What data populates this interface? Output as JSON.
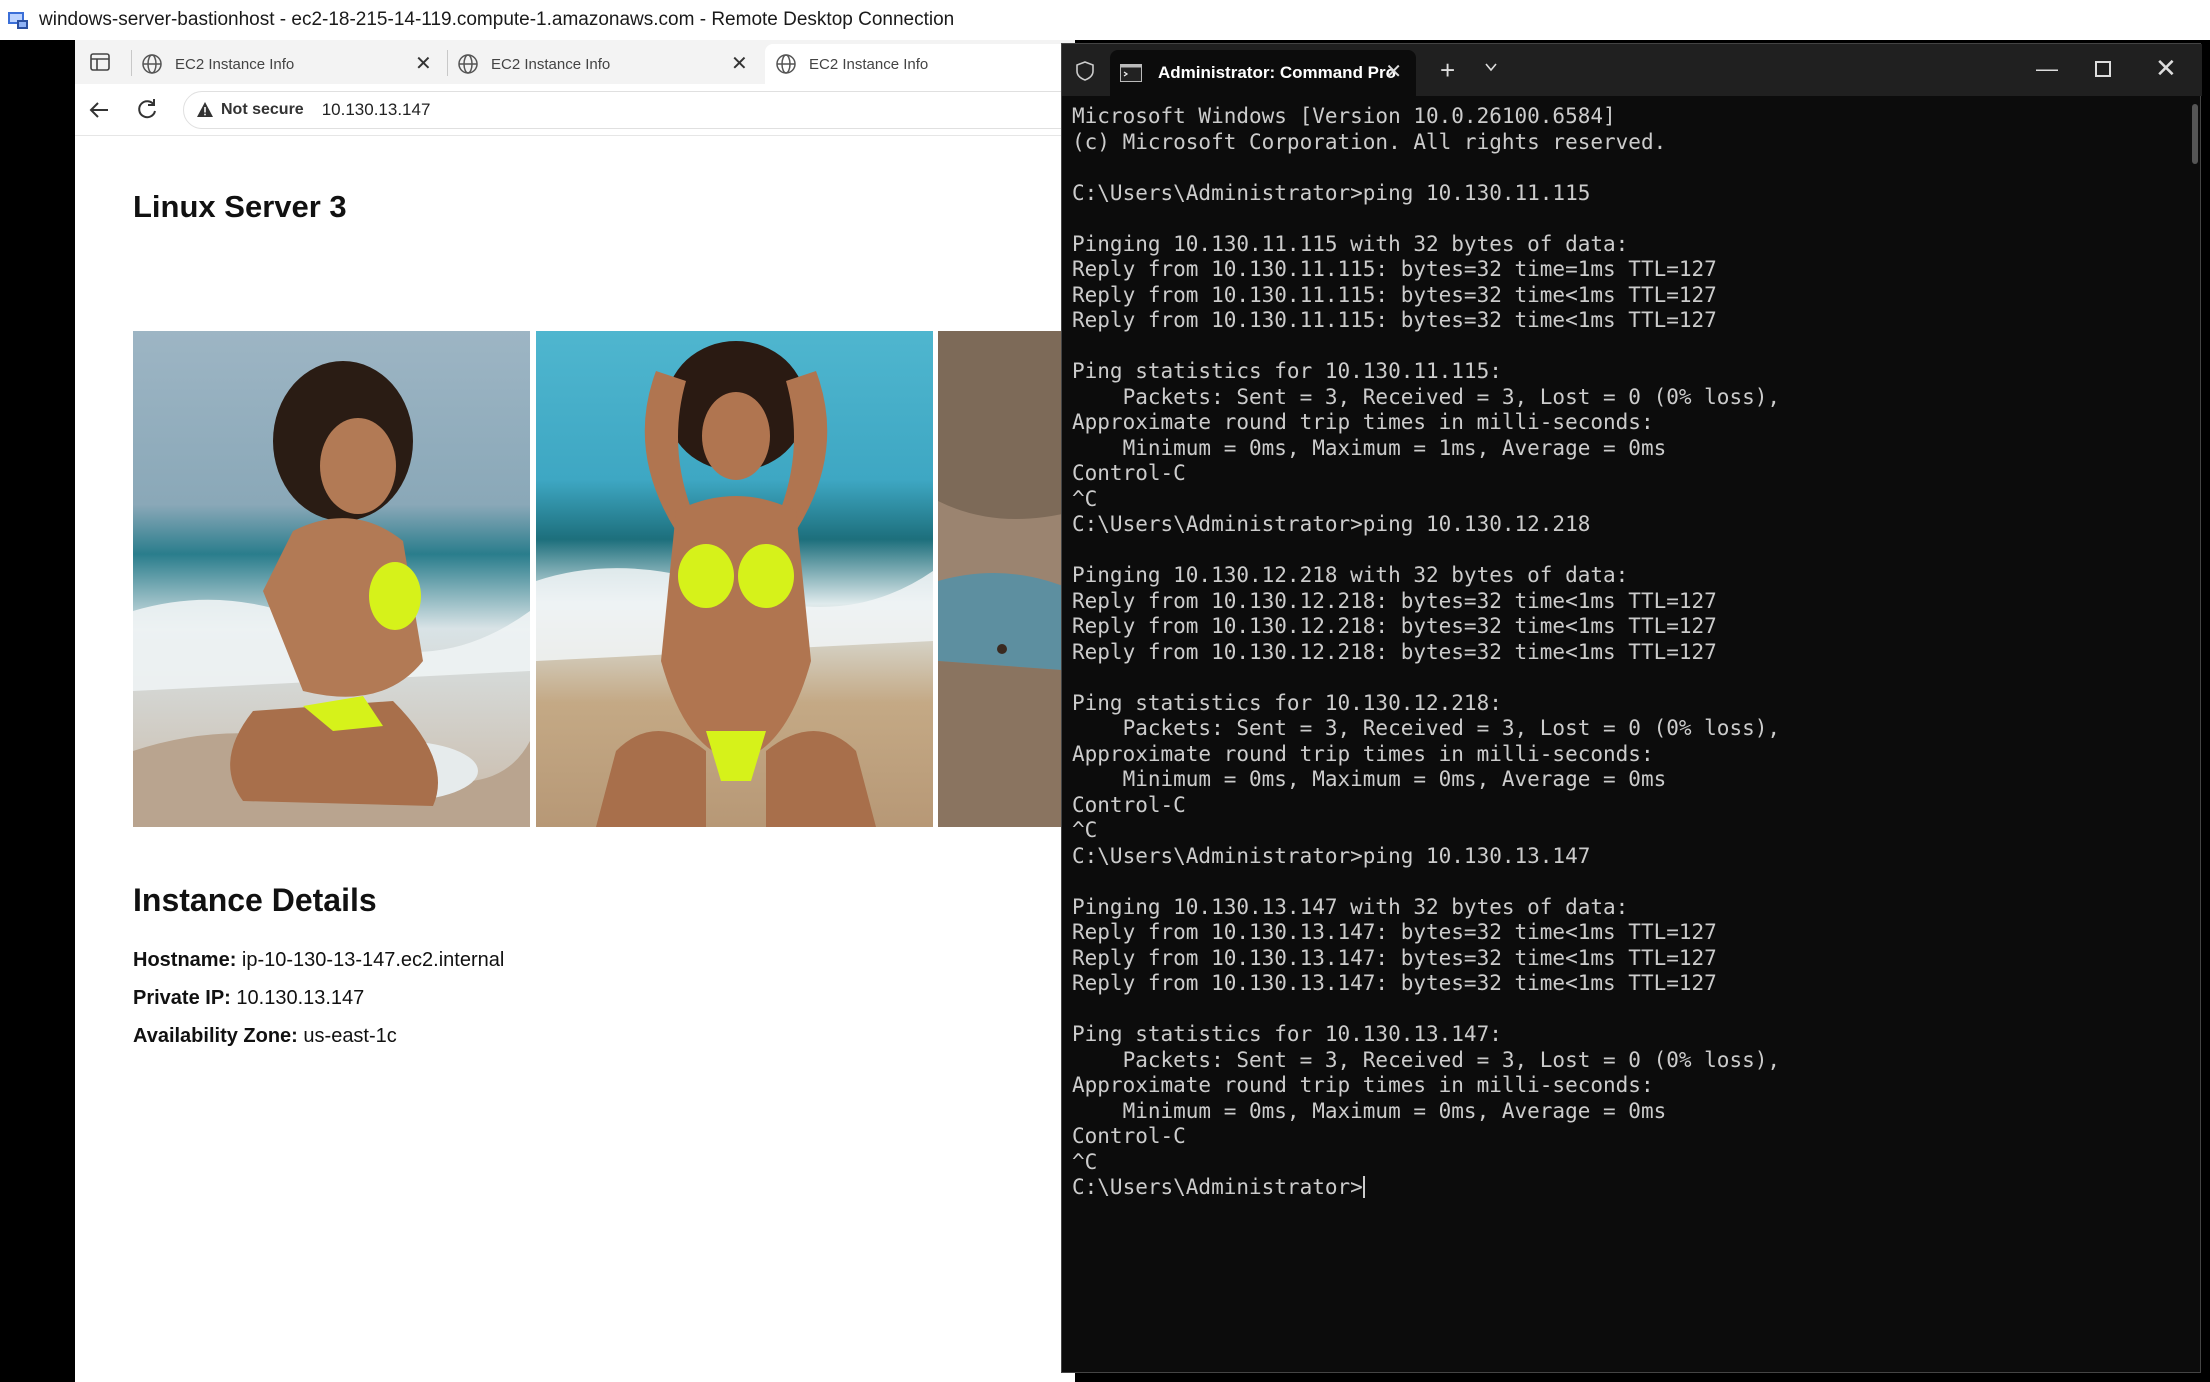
{
  "rdp": {
    "title": "windows-server-bastionhost - ec2-18-215-14-119.compute-1.amazonaws.com - Remote Desktop Connection"
  },
  "browser": {
    "tabs": [
      {
        "label": "EC2 Instance Info"
      },
      {
        "label": "EC2 Instance Info"
      },
      {
        "label": "EC2 Instance Info"
      }
    ],
    "not_secure": "Not secure",
    "url": "10.130.13.147",
    "page": {
      "title": "Linux Server 3",
      "details_heading": "Instance Details",
      "hostname_label": "Hostname:",
      "hostname": "ip-10-130-13-147.ec2.internal",
      "private_ip_label": "Private IP:",
      "private_ip": "10.130.13.147",
      "az_label": "Availability Zone:",
      "az": "us-east-1c"
    }
  },
  "terminal": {
    "tab_label": "Administrator: Command Pro",
    "lines": [
      "Microsoft Windows [Version 10.0.26100.6584]",
      "(c) Microsoft Corporation. All rights reserved.",
      "",
      "C:\\Users\\Administrator>ping 10.130.11.115",
      "",
      "Pinging 10.130.11.115 with 32 bytes of data:",
      "Reply from 10.130.11.115: bytes=32 time=1ms TTL=127",
      "Reply from 10.130.11.115: bytes=32 time<1ms TTL=127",
      "Reply from 10.130.11.115: bytes=32 time<1ms TTL=127",
      "",
      "Ping statistics for 10.130.11.115:",
      "    Packets: Sent = 3, Received = 3, Lost = 0 (0% loss),",
      "Approximate round trip times in milli-seconds:",
      "    Minimum = 0ms, Maximum = 1ms, Average = 0ms",
      "Control-C",
      "^C",
      "C:\\Users\\Administrator>ping 10.130.12.218",
      "",
      "Pinging 10.130.12.218 with 32 bytes of data:",
      "Reply from 10.130.12.218: bytes=32 time<1ms TTL=127",
      "Reply from 10.130.12.218: bytes=32 time<1ms TTL=127",
      "Reply from 10.130.12.218: bytes=32 time<1ms TTL=127",
      "",
      "Ping statistics for 10.130.12.218:",
      "    Packets: Sent = 3, Received = 3, Lost = 0 (0% loss),",
      "Approximate round trip times in milli-seconds:",
      "    Minimum = 0ms, Maximum = 0ms, Average = 0ms",
      "Control-C",
      "^C",
      "C:\\Users\\Administrator>ping 10.130.13.147",
      "",
      "Pinging 10.130.13.147 with 32 bytes of data:",
      "Reply from 10.130.13.147: bytes=32 time<1ms TTL=127",
      "Reply from 10.130.13.147: bytes=32 time<1ms TTL=127",
      "Reply from 10.130.13.147: bytes=32 time<1ms TTL=127",
      "",
      "Ping statistics for 10.130.13.147:",
      "    Packets: Sent = 3, Received = 3, Lost = 0 (0% loss),",
      "Approximate round trip times in milli-seconds:",
      "    Minimum = 0ms, Maximum = 0ms, Average = 0ms",
      "Control-C",
      "^C"
    ],
    "prompt": "C:\\Users\\Administrator>"
  }
}
